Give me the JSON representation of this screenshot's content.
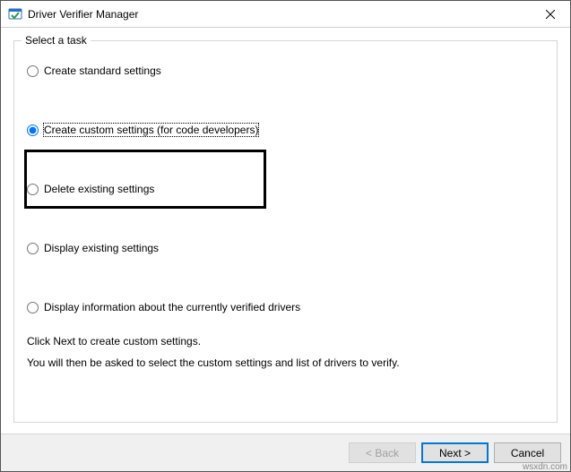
{
  "window": {
    "title": "Driver Verifier Manager"
  },
  "group": {
    "title": "Select a task"
  },
  "options": {
    "create_standard": "Create standard settings",
    "create_custom": "Create custom settings (for code developers)",
    "delete_existing": "Delete existing settings",
    "display_existing": "Display existing settings",
    "display_info": "Display information about the currently verified drivers"
  },
  "instructions": {
    "line1": "Click Next to create custom settings.",
    "line2": "You will then be asked to select the custom settings and list of drivers to verify."
  },
  "buttons": {
    "back": "< Back",
    "next": "Next >",
    "cancel": "Cancel"
  },
  "watermark": "wsxdn.com"
}
